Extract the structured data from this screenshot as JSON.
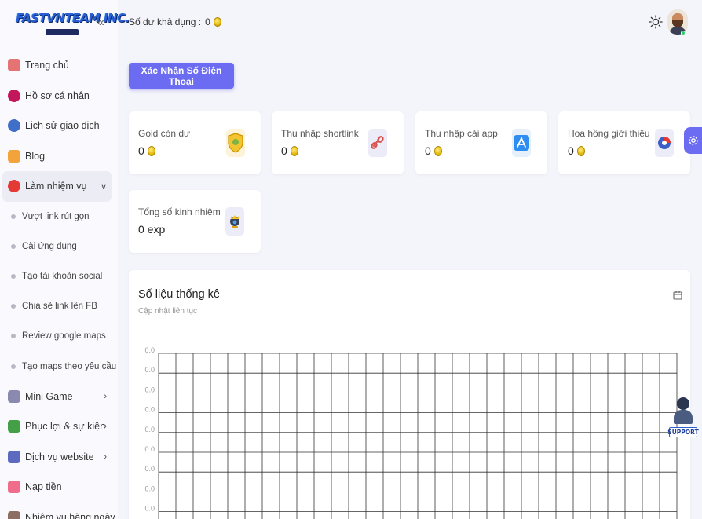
{
  "logo": {
    "text": "FASTVNTEAM INC."
  },
  "header": {
    "balance_label": "Số dư khả dụng :",
    "balance_value": "0"
  },
  "sidebar": {
    "items": [
      {
        "label": "Trang chủ",
        "icon": "home-icon",
        "color": "#e57373"
      },
      {
        "label": "Hồ sơ cá nhân",
        "icon": "user-icon",
        "color": "#c2185b"
      },
      {
        "label": "Lịch sử giao dịch",
        "icon": "history-icon",
        "color": "#3f6fc9"
      },
      {
        "label": "Blog",
        "icon": "blog-icon",
        "color": "#f2a33a"
      },
      {
        "label": "Làm nhiệm vụ",
        "icon": "target-icon",
        "color": "#e53935",
        "active": true
      },
      {
        "label": "Mini Game",
        "icon": "gamepad-icon",
        "color": "#8a8ab0"
      },
      {
        "label": "Phục lợi & sự kiện",
        "icon": "gift-icon",
        "color": "#43a047"
      },
      {
        "label": "Dịch vụ website",
        "icon": "web-service-icon",
        "color": "#5c6bc0"
      },
      {
        "label": "Nạp tiền",
        "icon": "deposit-icon",
        "color": "#ef6c8a"
      },
      {
        "label": "Nhiệm vụ hàng ngày",
        "icon": "daily-task-icon",
        "color": "#8d6e63"
      }
    ],
    "subitems": [
      "Vượt link rút gọn",
      "Cài ứng dụng",
      "Tạo tài khoản social",
      "Chia sẻ link lên FB",
      "Review google maps",
      "Tạo maps theo yêu cầu"
    ]
  },
  "verify_button": "Xác Nhận Số Điện Thoại",
  "stats": [
    {
      "label": "Gold còn dư",
      "value": "0",
      "icon": "gold-shield-icon",
      "bg": "#fdf3d8"
    },
    {
      "label": "Thu nhập shortlink",
      "value": "0",
      "icon": "link-icon",
      "bg": "#ececf8"
    },
    {
      "label": "Thu nhập cài app",
      "value": "0",
      "icon": "app-store-icon",
      "bg": "#e6f0fc"
    },
    {
      "label": "Hoa hồng giới thiệu",
      "value": "0",
      "icon": "referral-icon",
      "bg": "#ececf8"
    },
    {
      "label": "Tổng số kinh nhiệm",
      "value": "0 exp",
      "icon": "trophy-icon",
      "bg": "#ececf8"
    }
  ],
  "chart": {
    "title": "Số liệu thống kê",
    "subtitle": "Cập nhật liên tục"
  },
  "chart_data": {
    "type": "line",
    "y_ticks": [
      "0.0",
      "0.0",
      "0.0",
      "0.0",
      "0.0",
      "0.0",
      "0.0",
      "0.0",
      "0.0"
    ],
    "ylim": [
      0,
      0
    ],
    "grid": true,
    "series": []
  },
  "support_label": "SUPPORT",
  "colors": {
    "accent": "#6c6cf2",
    "online": "#2ecc71"
  }
}
